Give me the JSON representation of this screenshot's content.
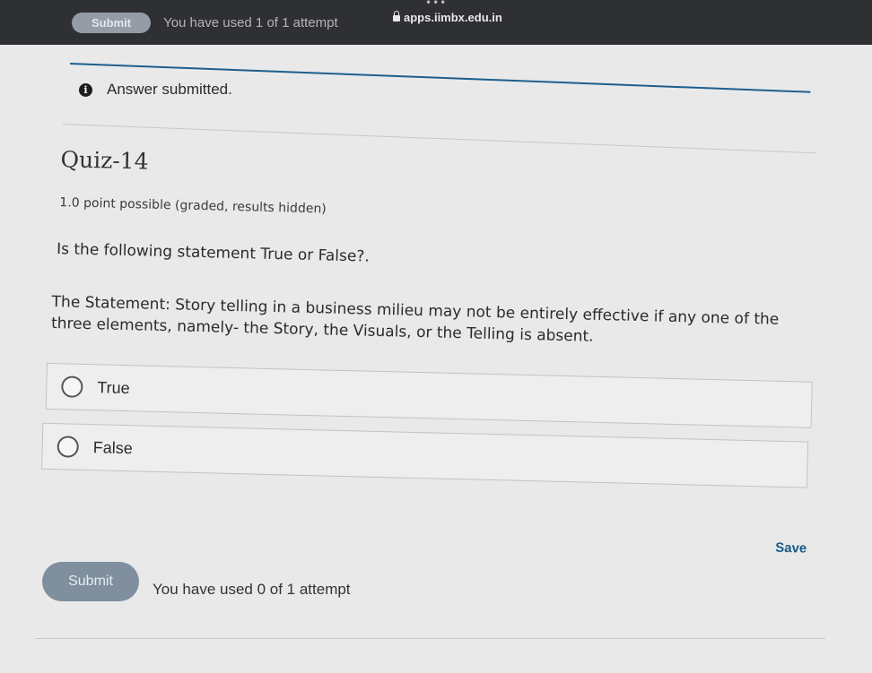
{
  "browser": {
    "url": "apps.iimbx.edu.in",
    "lock_icon": "lock-icon",
    "menu_icon": "dots-icon"
  },
  "previous_attempt": {
    "submit_label": "Submit",
    "attempt_text": "You have used 1 of 1 attempt"
  },
  "notice": {
    "icon": "info-icon",
    "text": "Answer submitted."
  },
  "problem": {
    "title": "Quiz-14",
    "points": "1.0 point possible (graded, results hidden)",
    "question": "Is the following statement True or False?.",
    "statement": "The Statement: Story telling in a business milieu may not be entirely effective if any one of the three elements, namely- the Story, the Visuals, or the Telling is absent.",
    "options": [
      {
        "label": "True",
        "selected": false
      },
      {
        "label": "False",
        "selected": false
      }
    ]
  },
  "actions": {
    "save_label": "Save",
    "submit_label": "Submit",
    "attempt_text": "You have used 0 of 1 attempt"
  },
  "colors": {
    "link": "#1a5c87",
    "submit_button": "#7f8f9d",
    "divider_accent": "#1d5e8e"
  }
}
